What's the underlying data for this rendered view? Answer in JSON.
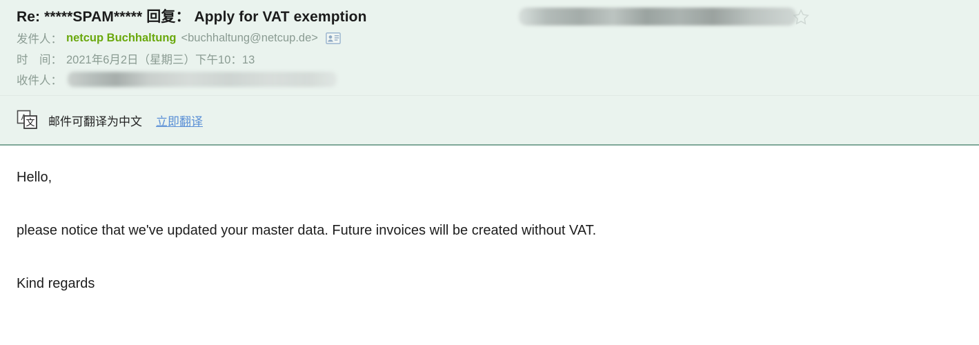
{
  "header": {
    "subject": "Re: *****SPAM***** 回复： Apply for VAT exemption",
    "subject_redacted": true,
    "star_icon": "star-outline-icon",
    "from": {
      "label": "发件人：",
      "name": "netcup Buchhaltung",
      "email": "<buchhaltung@netcup.de>",
      "contact_icon": "contact-card-icon"
    },
    "date": {
      "label": "时　间：",
      "value": "2021年6月2日（星期三）下午10：13"
    },
    "to": {
      "label": "收件人：",
      "value": "",
      "redacted": true
    }
  },
  "translate_bar": {
    "icon": "translate-icon",
    "message": "邮件可翻译为中文",
    "action_label": "立即翻译"
  },
  "body": {
    "paragraphs": [
      "Hello,",
      "please notice that we've updated your master data. Future invoices will be created without VAT.",
      "Kind regards"
    ]
  },
  "colors": {
    "header_background": "#eaf3ee",
    "body_background": "#ffffff",
    "sender_name": "#6aa80d",
    "meta_label": "#8a9b92",
    "link": "#5a8fd6",
    "divider": "#7fa898"
  }
}
